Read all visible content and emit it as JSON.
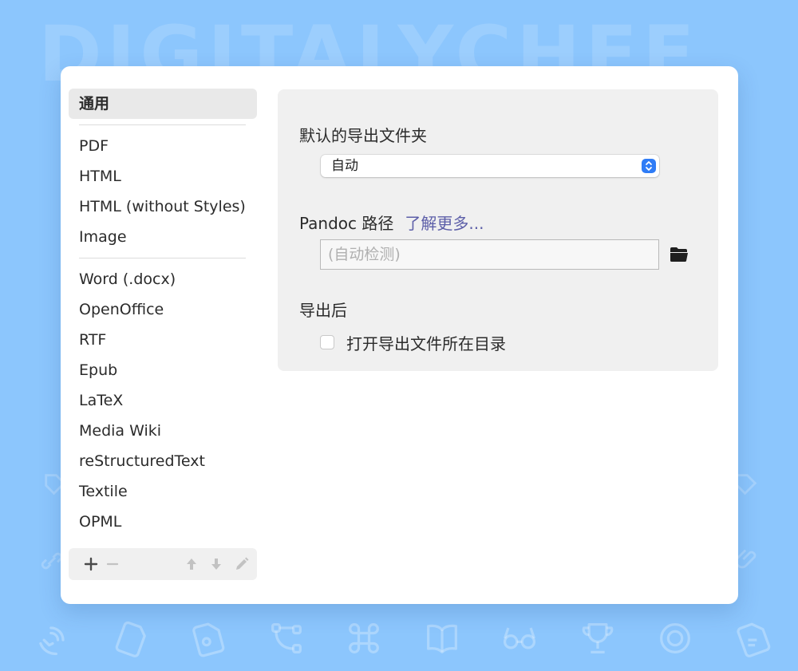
{
  "background": {
    "watermark": "DIGITALYCHEF",
    "color": "#8cc6fd",
    "icons": [
      "wifi-hand-icon",
      "memory-card-icon",
      "tag-icon",
      "vector-icon",
      "command-icon",
      "book-icon",
      "glasses-icon",
      "trophy-icon",
      "coin-icon",
      "tag-icon"
    ]
  },
  "sidebar": {
    "general": "通用",
    "group1": [
      "PDF",
      "HTML",
      "HTML (without Styles)",
      "Image"
    ],
    "group2": [
      "Word (.docx)",
      "OpenOffice",
      "RTF",
      "Epub",
      "LaTeX",
      "Media Wiki",
      "reStructuredText",
      "Textile",
      "OPML"
    ],
    "toolbar": {
      "add": "add-icon",
      "remove": "remove-icon",
      "move_up": "arrow-up-icon",
      "move_down": "arrow-down-icon",
      "edit": "pencil-icon"
    }
  },
  "panel": {
    "export_folder_label": "默认的导出文件夹",
    "export_folder_value": "自动",
    "pandoc_label": "Pandoc 路径",
    "learn_more": "了解更多...",
    "pandoc_placeholder": "(自动检测)",
    "pandoc_value": "",
    "after_export_label": "导出后",
    "open_folder_checkbox_label": "打开导出文件所在目录",
    "open_folder_checked": false
  },
  "colors": {
    "accent": "#2f7cf6",
    "link": "#5c5ea8",
    "panel_bg": "#f0f0f0"
  }
}
